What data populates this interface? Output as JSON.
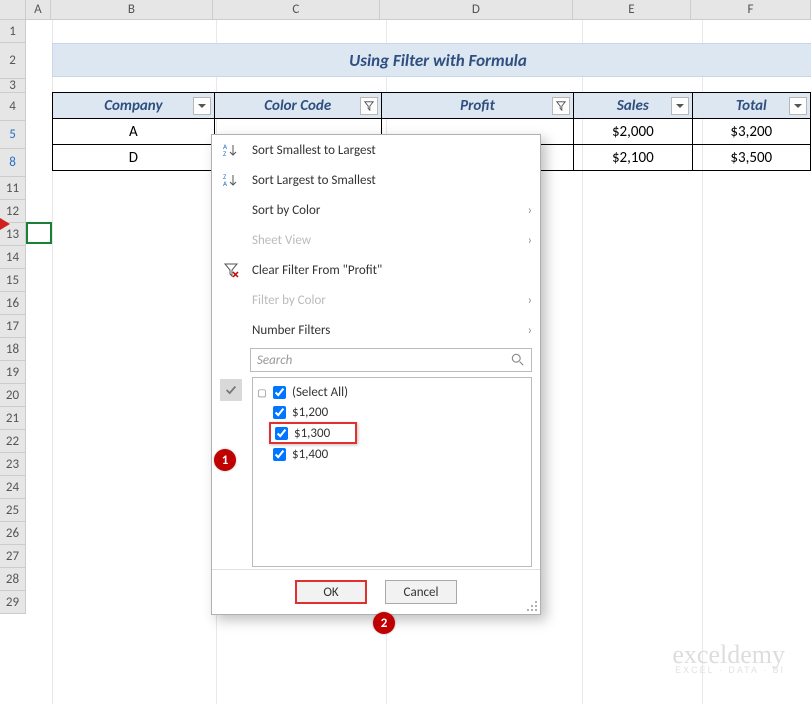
{
  "columns": [
    {
      "label": "A",
      "w": 26
    },
    {
      "label": "B",
      "w": 164
    },
    {
      "label": "C",
      "w": 170
    },
    {
      "label": "D",
      "w": 196
    },
    {
      "label": "E",
      "w": 120
    },
    {
      "label": "F",
      "w": 122
    }
  ],
  "rows": [
    {
      "label": "1"
    },
    {
      "label": "2"
    },
    {
      "label": "3"
    },
    {
      "label": "4"
    },
    {
      "label": "5",
      "blue": true
    },
    {
      "label": "8",
      "blue": true
    },
    {
      "label": "11"
    },
    {
      "label": "12"
    },
    {
      "label": "13"
    },
    {
      "label": "14"
    },
    {
      "label": "15"
    },
    {
      "label": "16"
    },
    {
      "label": "17"
    },
    {
      "label": "18"
    },
    {
      "label": "19"
    },
    {
      "label": "20"
    },
    {
      "label": "21"
    },
    {
      "label": "22"
    },
    {
      "label": "23"
    },
    {
      "label": "24"
    },
    {
      "label": "25"
    },
    {
      "label": "26"
    },
    {
      "label": "27"
    },
    {
      "label": "28"
    },
    {
      "label": "29"
    }
  ],
  "title": "Using Filter with Formula",
  "headers": {
    "company": "Company",
    "color_code": "Color Code",
    "profit": "Profit",
    "sales": "Sales",
    "total": "Total"
  },
  "table": [
    {
      "company": "A",
      "sales": "$2,000",
      "total": "$3,200"
    },
    {
      "company": "D",
      "sales": "$2,100",
      "total": "$3,500"
    }
  ],
  "menu": {
    "sort_asc": "Sort Smallest to Largest",
    "sort_desc": "Sort Largest to Smallest",
    "sort_color": "Sort by Color",
    "sheet_view": "Sheet View",
    "clear": "Clear Filter From \"Profit\"",
    "filter_color": "Filter by Color",
    "num_filters": "Number Filters",
    "search_placeholder": "Search",
    "items": [
      "(Select All)",
      "$1,200",
      "$1,300",
      "$1,400"
    ],
    "ok": "OK",
    "cancel": "Cancel"
  },
  "callouts": {
    "one": "1",
    "two": "2"
  },
  "watermark": {
    "main": "exceldemy",
    "sub": "EXCEL · DATA · BI"
  }
}
